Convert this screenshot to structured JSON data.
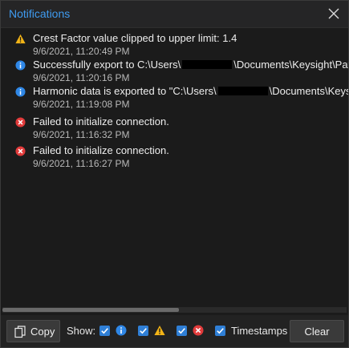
{
  "window": {
    "title": "Notifications"
  },
  "notifications": [
    {
      "type": "warning",
      "icon": "warning-icon",
      "message": "Crest Factor value clipped to upper limit: 1.4",
      "timestamp": "9/6/2021, 11:20:49 PM"
    },
    {
      "type": "info",
      "icon": "info-icon",
      "message_pre": "Successfully export to C:\\Users\\",
      "message_post": "\\Documents\\Keysight\\PathWa",
      "timestamp": "9/6/2021, 11:20:16 PM"
    },
    {
      "type": "info",
      "icon": "info-icon",
      "message_pre": "Harmonic data is exported to \"C:\\Users\\",
      "message_post": "\\Documents\\Keysight\\",
      "timestamp": "9/6/2021, 11:19:08 PM"
    },
    {
      "type": "error",
      "icon": "error-icon",
      "message": "Failed to initialize connection.",
      "timestamp": "9/6/2021, 11:16:32 PM"
    },
    {
      "type": "error",
      "icon": "error-icon",
      "message": "Failed to initialize connection.",
      "timestamp": "9/6/2021, 11:16:27 PM"
    }
  ],
  "footer": {
    "copy_label": "Copy",
    "show_label": "Show:",
    "filters": {
      "info": true,
      "warning": true,
      "error": true
    },
    "timestamps_label": "Timestamps",
    "timestamps_checked": true,
    "clear_label": "Clear"
  },
  "colors": {
    "accent": "#3f9bf0",
    "info": "#2f87e6",
    "warning": "#f2b417",
    "error": "#e23b3b",
    "checkbox": "#2f7fd6"
  }
}
